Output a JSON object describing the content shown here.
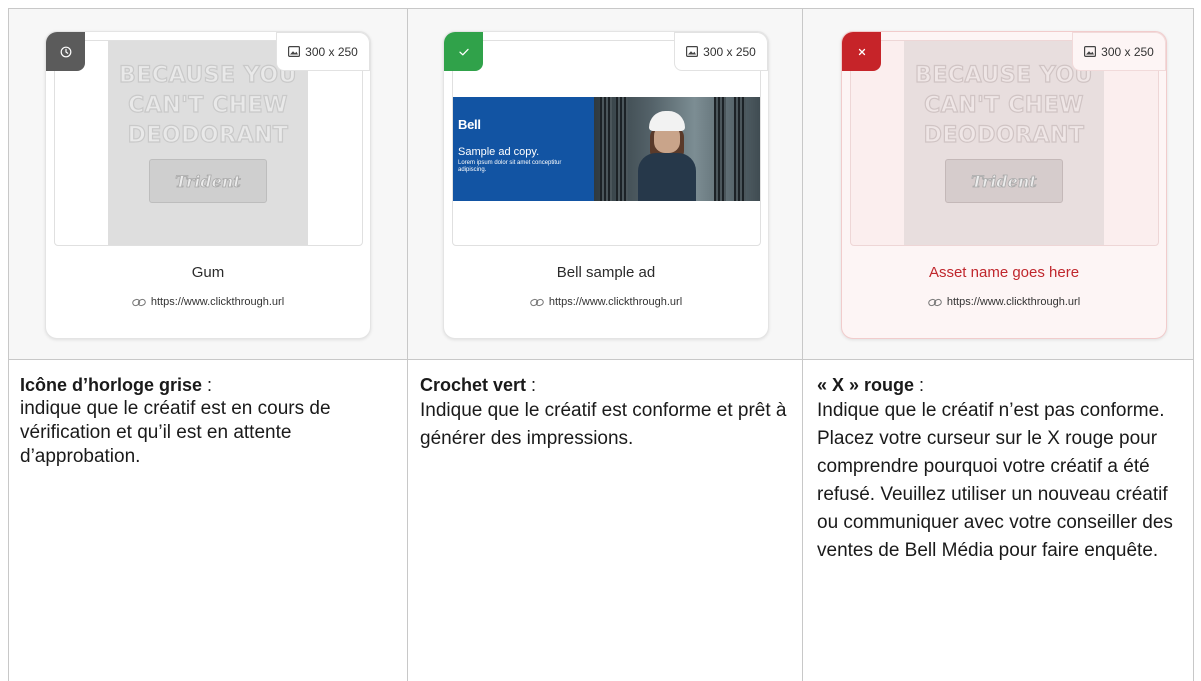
{
  "cards": [
    {
      "status": "pending",
      "status_icon": "clock-icon",
      "size_label": "300 x 250",
      "ad": {
        "kind": "gum",
        "headline": "BECAUSE YOU\nCAN'T CHEW\nDEODORANT",
        "brand": "Trident"
      },
      "title": "Gum",
      "url": "https://www.clickthrough.url"
    },
    {
      "status": "approved",
      "status_icon": "checkmark-icon",
      "size_label": "300 x 250",
      "ad": {
        "kind": "bell",
        "brand": "Bell",
        "copy": "Sample ad copy.",
        "small_copy": "Lorem ipsum dolor sit amet conceptitur adipiscing."
      },
      "title": "Bell sample ad",
      "url": "https://www.clickthrough.url"
    },
    {
      "status": "rejected",
      "status_icon": "close-x-icon",
      "size_label": "300 x 250",
      "ad": {
        "kind": "gum",
        "headline": "BECAUSE YOU\nCAN'T CHEW\nDEODORANT",
        "brand": "Trident"
      },
      "title": "Asset name goes here",
      "url": "https://www.clickthrough.url"
    }
  ],
  "descriptions": [
    {
      "label": "Icône d’horloge grise",
      "separator": " :",
      "text": "indique que le créatif est en cours de vérification et qu’il est en attente d’approbation."
    },
    {
      "label": "Crochet vert",
      "separator": " :",
      "text": "Indique que le créatif est conforme et prêt à générer des impressions."
    },
    {
      "label": "« X » rouge",
      "separator": " :",
      "text": "Indique que le créatif n’est pas conforme. Placez votre curseur sur le X rouge pour comprendre pourquoi votre créatif a été refusé. Veuillez utiliser un nouveau créatif ou communiquer avec votre conseiller des ventes de Bell Média pour faire enquête."
    }
  ],
  "colors": {
    "pending": "#5b5b5b",
    "approved": "#30a24a",
    "rejected": "#c62429",
    "bell_blue": "#1254a3",
    "rejected_text": "#c0272d"
  }
}
